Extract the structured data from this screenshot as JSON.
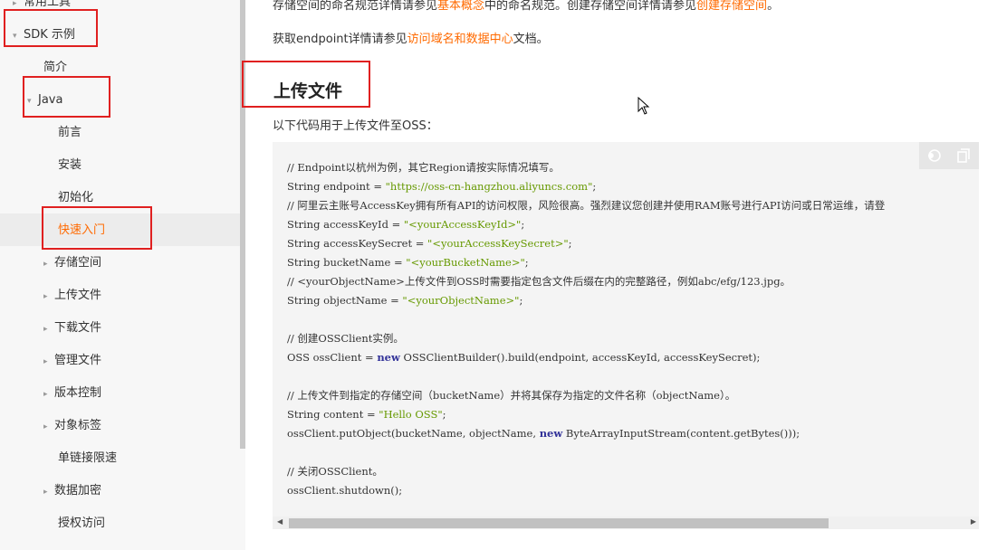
{
  "sidebar": {
    "items": [
      {
        "label": "常用工具",
        "caret": "▸"
      },
      {
        "label": "SDK 示例",
        "caret": "▾"
      },
      {
        "label": "简介",
        "caret": ""
      },
      {
        "label": "Java",
        "caret": "▾"
      },
      {
        "label": "前言",
        "caret": ""
      },
      {
        "label": "安装",
        "caret": ""
      },
      {
        "label": "初始化",
        "caret": ""
      },
      {
        "label": "快速入门",
        "caret": ""
      },
      {
        "label": "存储空间",
        "caret": "▸"
      },
      {
        "label": "上传文件",
        "caret": "▸"
      },
      {
        "label": "下载文件",
        "caret": "▸"
      },
      {
        "label": "管理文件",
        "caret": "▸"
      },
      {
        "label": "版本控制",
        "caret": "▸"
      },
      {
        "label": "对象标签",
        "caret": "▸"
      },
      {
        "label": "单链接限速",
        "caret": ""
      },
      {
        "label": "数据加密",
        "caret": "▸"
      },
      {
        "label": "授权访问",
        "caret": ""
      }
    ]
  },
  "main": {
    "para1": {
      "pre": "存储空间的命名规范详情请参见",
      "link1": "基本概念",
      "mid": "中的命名规范。创建存储空间详情请参见",
      "link2": "创建存储空间",
      "post": "。"
    },
    "para2": {
      "pre": "获取endpoint详情请参见",
      "link": "访问域名和数据中心",
      "post": "文档。"
    },
    "heading": "上传文件",
    "intro": "以下代码用于上传文件至OSS：",
    "code": {
      "lines": [
        {
          "parts": [
            {
              "t": "// Endpoint以杭州为例，其它Region请按实际情况填写。",
              "c": ""
            }
          ]
        },
        {
          "parts": [
            {
              "t": "String endpoint = ",
              "c": ""
            },
            {
              "t": "\"https://oss-cn-hangzhou.aliyuncs.com\"",
              "c": "str"
            },
            {
              "t": ";",
              "c": ""
            }
          ]
        },
        {
          "parts": [
            {
              "t": "// 阿里云主账号AccessKey拥有所有API的访问权限，风险很高。强烈建议您创建并使用RAM账号进行API访问或日常运维，请登",
              "c": ""
            }
          ]
        },
        {
          "parts": [
            {
              "t": "String accessKeyId = ",
              "c": ""
            },
            {
              "t": "\"<yourAccessKeyId>\"",
              "c": "str"
            },
            {
              "t": ";",
              "c": ""
            }
          ]
        },
        {
          "parts": [
            {
              "t": "String accessKeySecret = ",
              "c": ""
            },
            {
              "t": "\"<yourAccessKeySecret>\"",
              "c": "str"
            },
            {
              "t": ";",
              "c": ""
            }
          ]
        },
        {
          "parts": [
            {
              "t": "String bucketName = ",
              "c": ""
            },
            {
              "t": "\"<yourBucketName>\"",
              "c": "str"
            },
            {
              "t": ";",
              "c": ""
            }
          ]
        },
        {
          "parts": [
            {
              "t": "// <yourObjectName>上传文件到OSS时需要指定包含文件后缀在内的完整路径，例如abc/efg/123.jpg。",
              "c": ""
            }
          ]
        },
        {
          "parts": [
            {
              "t": "String objectName = ",
              "c": ""
            },
            {
              "t": "\"<yourObjectName>\"",
              "c": "str"
            },
            {
              "t": ";",
              "c": ""
            }
          ]
        },
        {
          "parts": [
            {
              "t": "",
              "c": ""
            }
          ]
        },
        {
          "parts": [
            {
              "t": "// 创建OSSClient实例。",
              "c": ""
            }
          ]
        },
        {
          "parts": [
            {
              "t": "OSS ossClient = ",
              "c": ""
            },
            {
              "t": "new",
              "c": "kw"
            },
            {
              "t": " OSSClientBuilder().build(endpoint, accessKeyId, accessKeySecret);",
              "c": ""
            }
          ]
        },
        {
          "parts": [
            {
              "t": "",
              "c": ""
            }
          ]
        },
        {
          "parts": [
            {
              "t": "// 上传文件到指定的存储空间（bucketName）并将其保存为指定的文件名称（objectName）。",
              "c": ""
            }
          ]
        },
        {
          "parts": [
            {
              "t": "String content = ",
              "c": ""
            },
            {
              "t": "\"Hello OSS\"",
              "c": "str"
            },
            {
              "t": ";",
              "c": ""
            }
          ]
        },
        {
          "parts": [
            {
              "t": "ossClient.putObject(bucketName, objectName, ",
              "c": ""
            },
            {
              "t": "new",
              "c": "kw"
            },
            {
              "t": " ByteArrayInputStream(content.getBytes()));",
              "c": ""
            }
          ]
        },
        {
          "parts": [
            {
              "t": "",
              "c": ""
            }
          ]
        },
        {
          "parts": [
            {
              "t": "// 关闭OSSClient。",
              "c": ""
            }
          ]
        },
        {
          "parts": [
            {
              "t": "ossClient.shutdown();",
              "c": ""
            }
          ]
        }
      ]
    },
    "icons": {
      "toggle": "toggle-icon",
      "copy": "copy-icon",
      "cursor": "mouse-cursor-icon"
    }
  },
  "colors": {
    "link": "#ff6a00",
    "highlight": "#e02020",
    "string": "#669900",
    "keyword": "#333399"
  }
}
